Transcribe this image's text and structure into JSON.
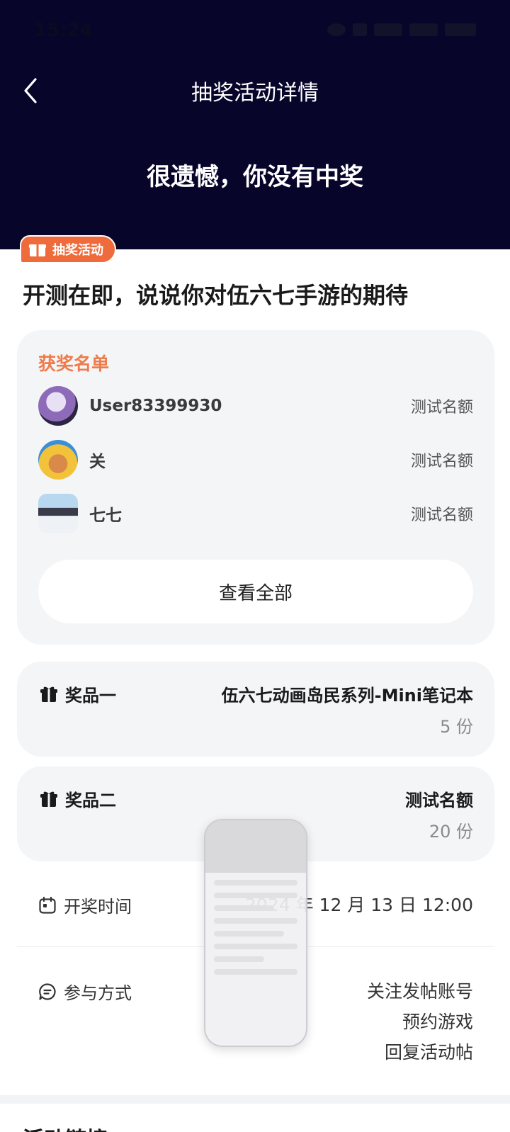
{
  "status_bar": {
    "time": "15:24"
  },
  "header": {
    "nav_title": "抽奖活动详情",
    "result_text": "很遗憾，你没有中奖"
  },
  "tag": {
    "label": "抽奖活动"
  },
  "post": {
    "title": "开测在即，说说你对伍六七手游的期待"
  },
  "winners": {
    "heading": "获奖名单",
    "rows": [
      {
        "name": "User83399930",
        "prize": "测试名额"
      },
      {
        "name": "关",
        "prize": "测试名额"
      },
      {
        "name": "七七",
        "prize": "测试名额"
      }
    ],
    "view_all_label": "查看全部"
  },
  "prizes": [
    {
      "label": "奖品一",
      "name": "伍六七动画岛民系列-Mini笔记本",
      "count": "5 份"
    },
    {
      "label": "奖品二",
      "name": "测试名额",
      "count": "20 份"
    }
  ],
  "draw": {
    "label": "开奖时间",
    "value": "2024 年 12 月 13 日 12:00"
  },
  "join": {
    "label": "参与方式",
    "methods": [
      "关注发帖账号",
      "预约游戏",
      "回复活动帖"
    ]
  },
  "section": {
    "title": "活动链接"
  },
  "colors": {
    "header_bg": "#07052a",
    "accent": "#ef6b3b",
    "card_bg": "#f4f5f7"
  }
}
